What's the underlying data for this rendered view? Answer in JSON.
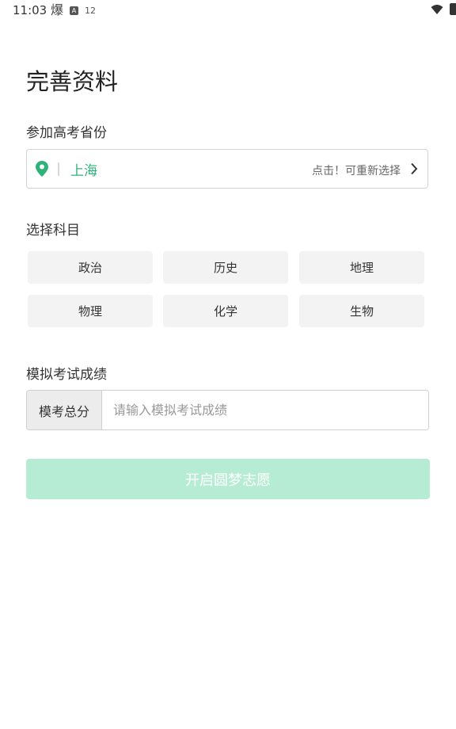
{
  "status_bar": {
    "time": "11:03",
    "notif_icons": [
      "爆",
      "A",
      "12"
    ],
    "notif_icon_names": [
      "app-notification-icon",
      "a-badge-icon",
      "temperature-icon"
    ]
  },
  "page_title": "完善资料",
  "province_section": {
    "label": "参加高考省份",
    "value": "上海",
    "hint": "点击！可重新选择"
  },
  "subjects_section": {
    "label": "选择科目",
    "items": [
      "政治",
      "历史",
      "地理",
      "物理",
      "化学",
      "生物"
    ]
  },
  "score_section": {
    "label": "模拟考试成绩",
    "prefix": "模考总分",
    "placeholder": "请输入模拟考试成绩",
    "value": ""
  },
  "submit_label": "开启圆梦志愿",
  "colors": {
    "accent_green": "#2db37a",
    "button_disabled": "#b6ecd4",
    "subject_bg": "#f3f3f3"
  }
}
